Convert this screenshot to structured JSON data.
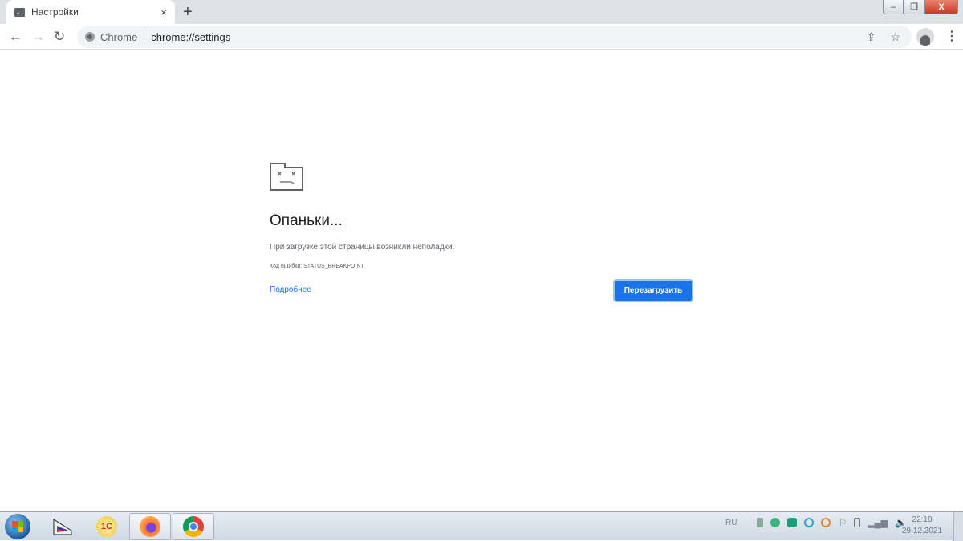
{
  "browser": {
    "tab": {
      "title": "Настройки",
      "close": "×"
    },
    "new_tab": "+",
    "window_controls": {
      "minimize": "‒",
      "maximize": "❐",
      "close": "X"
    },
    "nav": {
      "back": "←",
      "forward": "→",
      "reload": "↻"
    },
    "omnibox": {
      "chip": "Chrome",
      "url": "chrome://settings"
    },
    "toolbar_icons": {
      "share": "⇪",
      "bookmark": "☆",
      "menu": "⋮"
    }
  },
  "error_page": {
    "title": "Опаньки...",
    "message": "При загрузке этой страницы возникли неполадки.",
    "error_code": "Код ошибки: STATUS_BREAKPOINT",
    "details_link": "Подробнее",
    "reload_button": "Перезагрузить"
  },
  "taskbar": {
    "apps": [
      "scanner",
      "1C",
      "Firefox",
      "Chrome"
    ],
    "app_1c_label": "1С",
    "language": "RU",
    "time": "22:18",
    "date": "29.12.2021"
  },
  "colors": {
    "accent": "#1a73e8"
  }
}
